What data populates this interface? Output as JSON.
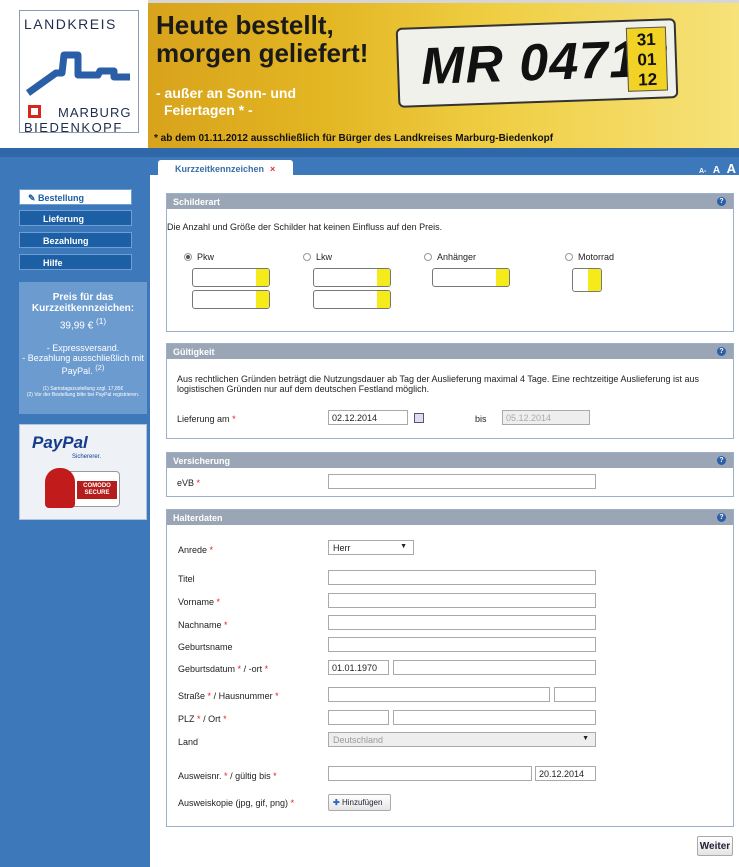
{
  "logo": {
    "line1": "LANDKREIS",
    "line2": "MARBURG",
    "line3": "BIEDENKOPF"
  },
  "promo": {
    "heading_line1": "Heute bestellt,",
    "heading_line2": "morgen geliefert!",
    "sub_line1": "- außer an Sonn- und",
    "sub_line2": "Feiertagen * -",
    "footnote": "* ab dem 01.11.2012 ausschließlich für Bürger des Landkreises Marburg-Biedenkopf",
    "plate_text": "MR 04712",
    "plate_date": [
      "31",
      "01",
      "12"
    ]
  },
  "tab": {
    "label": "Kurzzeitkennzeichen",
    "close": "×"
  },
  "font_sizes": [
    "A-",
    "A",
    "A"
  ],
  "nav": [
    {
      "label": "Bestellung",
      "active": true
    },
    {
      "label": "Lieferung"
    },
    {
      "label": "Bezahlung"
    },
    {
      "label": "Hilfe"
    }
  ],
  "info": {
    "price_title": "Preis für das Kurzzeitkennzeichen:",
    "price": "39,99 €",
    "price_sup": "(1)",
    "express": "- Expressversand.",
    "paypal_note": "- Bezahlung ausschließlich mit PayPal.",
    "paypal_sup": "(2)",
    "fn1": "(1) Samstagszustellung zzgl. 17,85€",
    "fn2": "(2) Vor der Bestellung bitte bei PayPal registrieren."
  },
  "badges": {
    "paypal": "PayPal",
    "paypal_tag": "Sichererer.",
    "comodo": "COMODO SECURE"
  },
  "schilderart": {
    "title": "Schilderart",
    "hint": "Die Anzahl und Größe der Schilder hat keinen Einfluss auf den Preis.",
    "options": [
      {
        "label": "Pkw",
        "selected": true
      },
      {
        "label": "Lkw",
        "selected": false
      },
      {
        "label": "Anhänger",
        "selected": false
      },
      {
        "label": "Motorrad",
        "selected": false
      }
    ]
  },
  "gueltigkeit": {
    "title": "Gültigkeit",
    "text": "Aus rechtlichen Gründen beträgt die Nutzungsdauer ab Tag der Auslieferung maximal 4 Tage. Eine rechtzeitige Auslieferung ist aus logistischen Gründen nur auf dem deutschen Festland möglich.",
    "lieferung_label": "Lieferung am",
    "from": "02.12.2014",
    "bis_label": "bis",
    "to": "05.12.2014"
  },
  "versicherung": {
    "title": "Versicherung",
    "evb_label": "eVB",
    "evb_value": ""
  },
  "halter": {
    "title": "Halterdaten",
    "anrede_label": "Anrede",
    "anrede_value": "Herr",
    "titel_label": "Titel",
    "vorname_label": "Vorname",
    "nachname_label": "Nachname",
    "geburtsname_label": "Geburtsname",
    "geburtsdatum_label": "Geburtsdatum",
    "ort_suffix": "/ -ort",
    "geburtsdatum_value": "01.01.1970",
    "strasse_label": "Straße",
    "hausnummer_suffix": "/ Hausnummer",
    "plz_label": "PLZ",
    "ort_label": "/ Ort",
    "land_label": "Land",
    "land_value": "Deutschland",
    "ausweis_label": "Ausweisnr.",
    "gueltig_suffix": "/ gültig bis",
    "gueltig_value": "20.12.2014",
    "kopie_label": "Ausweiskopie (jpg, gif, png)",
    "add_button": "Hinzufügen"
  },
  "weiter": "Weiter",
  "req": "*"
}
